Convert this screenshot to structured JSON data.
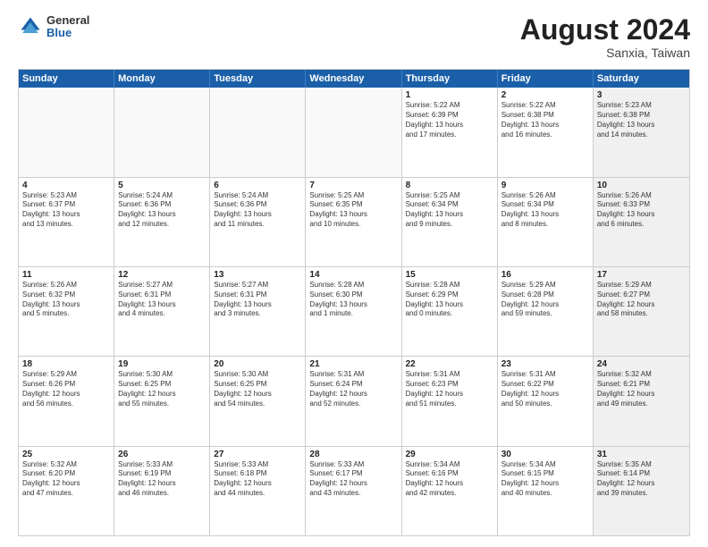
{
  "header": {
    "logo": {
      "general": "General",
      "blue": "Blue"
    },
    "month_year": "August 2024",
    "location": "Sanxia, Taiwan"
  },
  "weekdays": [
    "Sunday",
    "Monday",
    "Tuesday",
    "Wednesday",
    "Thursday",
    "Friday",
    "Saturday"
  ],
  "rows": [
    [
      {
        "day": "",
        "empty": true,
        "text": ""
      },
      {
        "day": "",
        "empty": true,
        "text": ""
      },
      {
        "day": "",
        "empty": true,
        "text": ""
      },
      {
        "day": "",
        "empty": true,
        "text": ""
      },
      {
        "day": "1",
        "text": "Sunrise: 5:22 AM\nSunset: 6:39 PM\nDaylight: 13 hours\nand 17 minutes."
      },
      {
        "day": "2",
        "text": "Sunrise: 5:22 AM\nSunset: 6:38 PM\nDaylight: 13 hours\nand 16 minutes."
      },
      {
        "day": "3",
        "shaded": true,
        "text": "Sunrise: 5:23 AM\nSunset: 6:38 PM\nDaylight: 13 hours\nand 14 minutes."
      }
    ],
    [
      {
        "day": "4",
        "text": "Sunrise: 5:23 AM\nSunset: 6:37 PM\nDaylight: 13 hours\nand 13 minutes."
      },
      {
        "day": "5",
        "text": "Sunrise: 5:24 AM\nSunset: 6:36 PM\nDaylight: 13 hours\nand 12 minutes."
      },
      {
        "day": "6",
        "text": "Sunrise: 5:24 AM\nSunset: 6:36 PM\nDaylight: 13 hours\nand 11 minutes."
      },
      {
        "day": "7",
        "text": "Sunrise: 5:25 AM\nSunset: 6:35 PM\nDaylight: 13 hours\nand 10 minutes."
      },
      {
        "day": "8",
        "text": "Sunrise: 5:25 AM\nSunset: 6:34 PM\nDaylight: 13 hours\nand 9 minutes."
      },
      {
        "day": "9",
        "text": "Sunrise: 5:26 AM\nSunset: 6:34 PM\nDaylight: 13 hours\nand 8 minutes."
      },
      {
        "day": "10",
        "shaded": true,
        "text": "Sunrise: 5:26 AM\nSunset: 6:33 PM\nDaylight: 13 hours\nand 6 minutes."
      }
    ],
    [
      {
        "day": "11",
        "text": "Sunrise: 5:26 AM\nSunset: 6:32 PM\nDaylight: 13 hours\nand 5 minutes."
      },
      {
        "day": "12",
        "text": "Sunrise: 5:27 AM\nSunset: 6:31 PM\nDaylight: 13 hours\nand 4 minutes."
      },
      {
        "day": "13",
        "text": "Sunrise: 5:27 AM\nSunset: 6:31 PM\nDaylight: 13 hours\nand 3 minutes."
      },
      {
        "day": "14",
        "text": "Sunrise: 5:28 AM\nSunset: 6:30 PM\nDaylight: 13 hours\nand 1 minute."
      },
      {
        "day": "15",
        "text": "Sunrise: 5:28 AM\nSunset: 6:29 PM\nDaylight: 13 hours\nand 0 minutes."
      },
      {
        "day": "16",
        "text": "Sunrise: 5:29 AM\nSunset: 6:28 PM\nDaylight: 12 hours\nand 59 minutes."
      },
      {
        "day": "17",
        "shaded": true,
        "text": "Sunrise: 5:29 AM\nSunset: 6:27 PM\nDaylight: 12 hours\nand 58 minutes."
      }
    ],
    [
      {
        "day": "18",
        "text": "Sunrise: 5:29 AM\nSunset: 6:26 PM\nDaylight: 12 hours\nand 56 minutes."
      },
      {
        "day": "19",
        "text": "Sunrise: 5:30 AM\nSunset: 6:25 PM\nDaylight: 12 hours\nand 55 minutes."
      },
      {
        "day": "20",
        "text": "Sunrise: 5:30 AM\nSunset: 6:25 PM\nDaylight: 12 hours\nand 54 minutes."
      },
      {
        "day": "21",
        "text": "Sunrise: 5:31 AM\nSunset: 6:24 PM\nDaylight: 12 hours\nand 52 minutes."
      },
      {
        "day": "22",
        "text": "Sunrise: 5:31 AM\nSunset: 6:23 PM\nDaylight: 12 hours\nand 51 minutes."
      },
      {
        "day": "23",
        "text": "Sunrise: 5:31 AM\nSunset: 6:22 PM\nDaylight: 12 hours\nand 50 minutes."
      },
      {
        "day": "24",
        "shaded": true,
        "text": "Sunrise: 5:32 AM\nSunset: 6:21 PM\nDaylight: 12 hours\nand 49 minutes."
      }
    ],
    [
      {
        "day": "25",
        "text": "Sunrise: 5:32 AM\nSunset: 6:20 PM\nDaylight: 12 hours\nand 47 minutes."
      },
      {
        "day": "26",
        "text": "Sunrise: 5:33 AM\nSunset: 6:19 PM\nDaylight: 12 hours\nand 46 minutes."
      },
      {
        "day": "27",
        "text": "Sunrise: 5:33 AM\nSunset: 6:18 PM\nDaylight: 12 hours\nand 44 minutes."
      },
      {
        "day": "28",
        "text": "Sunrise: 5:33 AM\nSunset: 6:17 PM\nDaylight: 12 hours\nand 43 minutes."
      },
      {
        "day": "29",
        "text": "Sunrise: 5:34 AM\nSunset: 6:16 PM\nDaylight: 12 hours\nand 42 minutes."
      },
      {
        "day": "30",
        "text": "Sunrise: 5:34 AM\nSunset: 6:15 PM\nDaylight: 12 hours\nand 40 minutes."
      },
      {
        "day": "31",
        "shaded": true,
        "text": "Sunrise: 5:35 AM\nSunset: 6:14 PM\nDaylight: 12 hours\nand 39 minutes."
      }
    ]
  ]
}
